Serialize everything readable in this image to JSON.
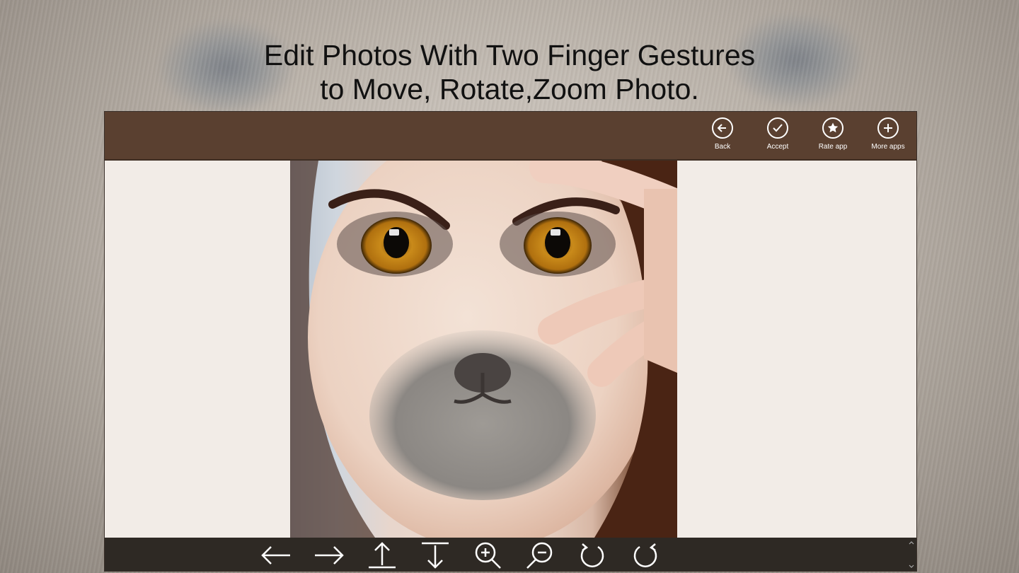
{
  "headline": {
    "line1": "Edit Photos With Two Finger Gestures",
    "line2": "to Move, Rotate,Zoom Photo."
  },
  "app_bar": {
    "buttons": [
      {
        "label": "Back",
        "icon": "arrow-left-circle-icon"
      },
      {
        "label": "Accept",
        "icon": "check-circle-icon"
      },
      {
        "label": "Rate app",
        "icon": "star-circle-icon"
      },
      {
        "label": "More apps",
        "icon": "plus-circle-icon"
      }
    ]
  },
  "toolbar": {
    "tools": [
      {
        "icon": "move-left-icon"
      },
      {
        "icon": "move-right-icon"
      },
      {
        "icon": "move-up-icon"
      },
      {
        "icon": "move-down-icon"
      },
      {
        "icon": "zoom-in-icon"
      },
      {
        "icon": "zoom-out-icon"
      },
      {
        "icon": "rotate-left-icon"
      },
      {
        "icon": "rotate-right-icon"
      }
    ]
  },
  "colors": {
    "app_bar": "#5a4030",
    "bottom_bar": "#2e2924",
    "canvas": "#f2ece7",
    "icon": "#ffffff"
  }
}
